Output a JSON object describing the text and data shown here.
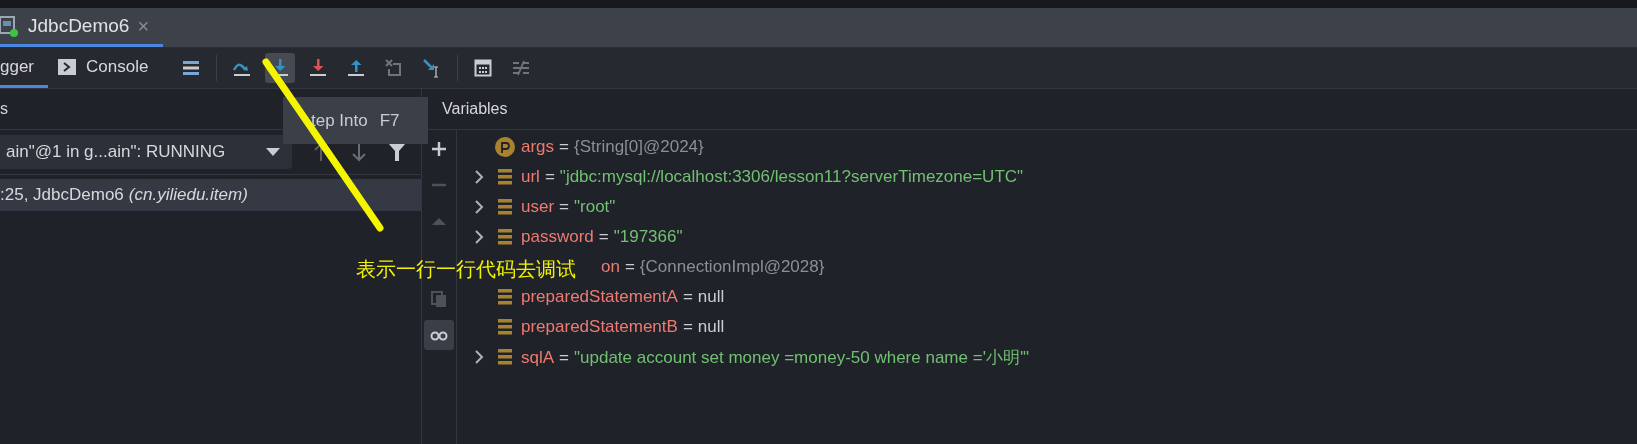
{
  "editor_tab": {
    "title": "JdbcDemo6",
    "close": "×"
  },
  "debug_tabs": [
    {
      "label": "gger",
      "kind": "debugger",
      "selected": true
    },
    {
      "label": "Console",
      "kind": "console",
      "selected": false
    }
  ],
  "toolbar": [
    {
      "kind": "layout",
      "selected": false,
      "disabled": false
    },
    {
      "kind": "step-over",
      "selected": false,
      "disabled": false
    },
    {
      "kind": "step-into",
      "selected": true,
      "disabled": false
    },
    {
      "kind": "force-step-into",
      "selected": false,
      "disabled": false
    },
    {
      "kind": "step-out",
      "selected": false,
      "disabled": false
    },
    {
      "kind": "drop-frame",
      "selected": false,
      "disabled": true
    },
    {
      "kind": "run-to-cursor",
      "selected": false,
      "disabled": false
    },
    {
      "kind": "evaluate",
      "selected": false,
      "disabled": false
    },
    {
      "kind": "trace",
      "selected": false,
      "disabled": true
    }
  ],
  "frames_panel": {
    "header": "s",
    "thread": "ain\"@1 in g...ain\": RUNNING",
    "frames": [
      {
        "location": ":25, JdbcDemo6",
        "package": "(cn.yiliedu.item)",
        "selected": true
      }
    ]
  },
  "tooltip": {
    "label": "tep Into",
    "shortcut": "F7"
  },
  "variables_panel": {
    "header": "Variables",
    "side_toolbar": [
      {
        "kind": "add",
        "disabled": false,
        "selected": false
      },
      {
        "kind": "remove",
        "disabled": true,
        "selected": false
      },
      {
        "kind": "up",
        "disabled": true,
        "selected": false
      },
      {
        "kind": "copy",
        "disabled": true,
        "selected": false
      },
      {
        "kind": "watches",
        "disabled": false,
        "selected": true
      }
    ],
    "variables": [
      {
        "kind": "param",
        "name": "args",
        "operator": "=",
        "value": "{String[0]@2024}",
        "color": "#8c8f94",
        "expandable": false
      },
      {
        "kind": "field",
        "name": "url",
        "operator": "=",
        "value": "\"jdbc:mysql://localhost:3306/lesson11?serverTimezone=UTC\"",
        "color": "#72c072",
        "expandable": true
      },
      {
        "kind": "field",
        "name": "user",
        "operator": "=",
        "value": "\"root\"",
        "color": "#72c072",
        "expandable": true
      },
      {
        "kind": "field",
        "name": "password",
        "operator": "=",
        "value": "\"197366\"",
        "color": "#72c072",
        "expandable": true
      },
      {
        "kind": "covered",
        "name": "on",
        "operator": "=",
        "value": "{ConnectionImpl@2028}",
        "color": "#8c8f94",
        "expandable": false
      },
      {
        "kind": "field",
        "name": "preparedStatementA",
        "operator": "=",
        "value": "null",
        "color": "#c9ccd1",
        "expandable": false
      },
      {
        "kind": "field",
        "name": "preparedStatementB",
        "operator": "=",
        "value": "null",
        "color": "#c9ccd1",
        "expandable": false
      },
      {
        "kind": "field",
        "name": "sqlA",
        "operator": "=",
        "value": "\"update account set money =money-50 where name ='小明'\"",
        "color": "#72c072",
        "expandable": true
      }
    ]
  },
  "annotation": {
    "text": "表示一行一行代码去调试"
  }
}
